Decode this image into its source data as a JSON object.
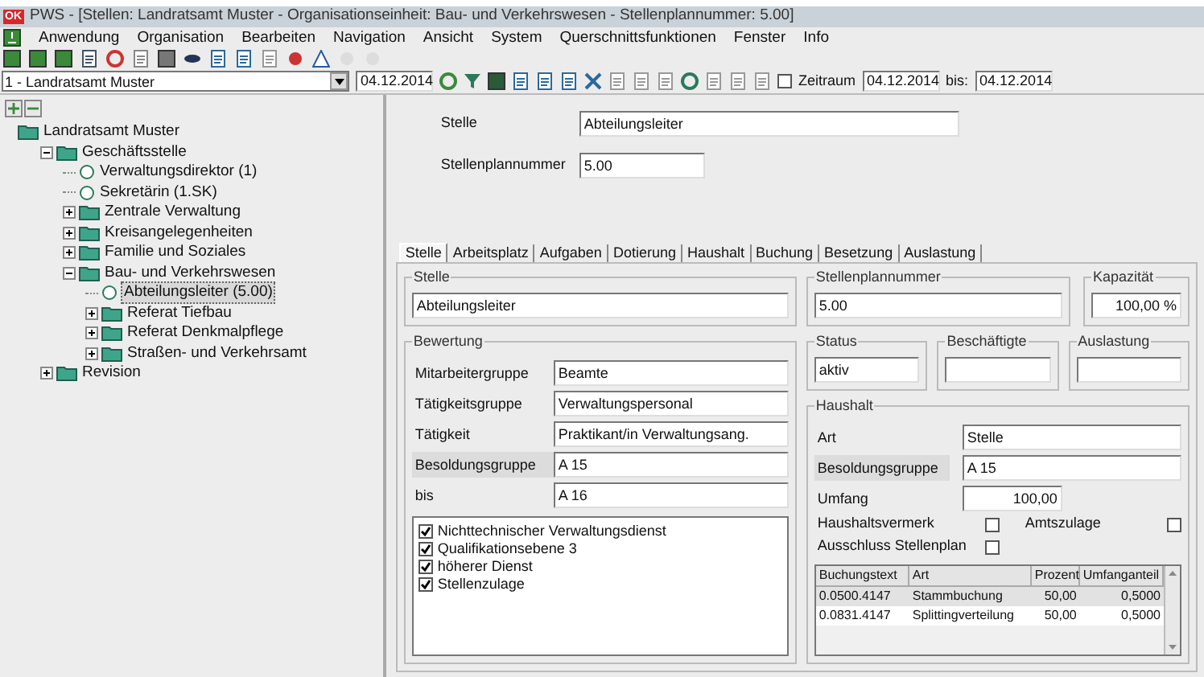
{
  "window": {
    "title": "PWS - [Stellen: Landratsamt Muster - Organisationseinheit: Bau- und Verkehrswesen - Stellenplannummer: 5.00]",
    "logo": "OK"
  },
  "menu": [
    "Anwendung",
    "Organisation",
    "Bearbeiten",
    "Navigation",
    "Ansicht",
    "System",
    "Querschnittsfunktionen",
    "Fenster",
    "Info"
  ],
  "toolbar": {
    "org_select": "1 - Landratsamt Muster",
    "date": "04.12.2014",
    "zeitraum": {
      "label": "Zeitraum",
      "checked": false
    },
    "from": "04.12.2014",
    "bis_label": "bis:",
    "to": "04.12.2014"
  },
  "tree": [
    {
      "label": "Landratsamt Muster",
      "kind": "folder",
      "selected": false,
      "children": [
        {
          "label": "Geschäftsstelle",
          "kind": "folder",
          "expanded": true,
          "selected": false,
          "children": [
            {
              "label": "Verwaltungsdirektor (1)",
              "kind": "position",
              "selected": false
            },
            {
              "label": "Sekretärin (1.SK)",
              "kind": "position",
              "selected": false
            },
            {
              "label": "Zentrale Verwaltung",
              "kind": "folder",
              "expanded": false,
              "selected": false
            },
            {
              "label": "Kreisangelegenheiten",
              "kind": "folder",
              "expanded": false,
              "selected": false
            },
            {
              "label": "Familie und Soziales",
              "kind": "folder",
              "expanded": false,
              "selected": false
            },
            {
              "label": "Bau- und Verkehrswesen",
              "kind": "folder",
              "expanded": true,
              "selected": false,
              "children": [
                {
                  "label": "Abteilungsleiter (5.00)",
                  "kind": "position",
                  "selected": true
                },
                {
                  "label": "Referat Tiefbau",
                  "kind": "folder",
                  "expanded": false,
                  "selected": false
                },
                {
                  "label": "Referat Denkmalpflege",
                  "kind": "folder",
                  "expanded": false,
                  "selected": false
                },
                {
                  "label": "Straßen- und Verkehrsamt",
                  "kind": "folder",
                  "expanded": false,
                  "selected": false
                }
              ]
            }
          ]
        },
        {
          "label": "Revision",
          "kind": "folder",
          "expanded": false,
          "selected": false
        }
      ]
    }
  ],
  "header": [
    {
      "label": "Stelle",
      "value": "Abteilungsleiter"
    },
    {
      "label": "Stellenplannummer",
      "value": "5.00"
    }
  ],
  "tabs": [
    {
      "label": "Stelle",
      "selected": true
    },
    {
      "label": "Arbeitsplatz",
      "selected": false
    },
    {
      "label": "Aufgaben",
      "selected": false
    },
    {
      "label": "Dotierung",
      "selected": false
    },
    {
      "label": "Haushalt",
      "selected": false
    },
    {
      "label": "Buchung",
      "selected": false
    },
    {
      "label": "Besetzung",
      "selected": false
    },
    {
      "label": "Auslastung",
      "selected": false
    }
  ],
  "stelle_group": {
    "title": "Stelle",
    "value": "Abteilungsleiter"
  },
  "stellenplannummer_group": {
    "title": "Stellenplannummer",
    "value": "5.00"
  },
  "kapazitaet_group": {
    "title": "Kapazität",
    "value": "100,00 %"
  },
  "bewertung": {
    "title": "Bewertung",
    "fields": [
      {
        "label": "Mitarbeitergruppe",
        "value": "Beamte",
        "shaded": false
      },
      {
        "label": "Tätigkeitsgruppe",
        "value": "Verwaltungspersonal",
        "shaded": false
      },
      {
        "label": "Tätigkeit",
        "value": "Praktikant/in Verwaltungsang.",
        "shaded": false
      },
      {
        "label": "Besoldungsgruppe",
        "value": "A 15",
        "shaded": true
      },
      {
        "label": "bis",
        "value": "A 16",
        "shaded": false
      }
    ],
    "checks": [
      {
        "label": "Nichttechnischer Verwaltungsdienst",
        "checked": true
      },
      {
        "label": "Qualifikationsebene 3",
        "checked": true
      },
      {
        "label": "höherer Dienst",
        "checked": true
      },
      {
        "label": "Stellenzulage",
        "checked": true
      }
    ]
  },
  "status_groups": [
    {
      "title": "Status",
      "value": "aktiv"
    },
    {
      "title": "Beschäftigte"
    },
    {
      "title": "Auslastung"
    }
  ],
  "haushalt": {
    "title": "Haushalt",
    "fields": [
      {
        "label": "Art",
        "value": "Stelle",
        "shaded": false
      },
      {
        "label": "Besoldungsgruppe",
        "value": "A 15",
        "shaded": true
      },
      {
        "label": "Umfang",
        "value": "100,00",
        "shaded": false
      }
    ],
    "haushaltsvermerk": {
      "label": "Haushaltsvermerk",
      "checked": false
    },
    "amtszulage": {
      "label": "Amtszulage",
      "checked": false
    },
    "ausschluss": {
      "label": "Ausschluss Stellenplan",
      "checked": false
    },
    "table": {
      "columns": [
        "Buchungstext",
        "Art",
        "Prozent",
        "Umfanganteil"
      ],
      "rows": [
        {
          "cells": [
            "0.0500.4147",
            "Stammbuchung",
            "50,00",
            "0,5000"
          ],
          "selected": true
        },
        {
          "cells": [
            "0.0831.4147",
            "Splittingverteilung",
            "50,00",
            "0,5000"
          ],
          "selected": false
        }
      ]
    }
  }
}
